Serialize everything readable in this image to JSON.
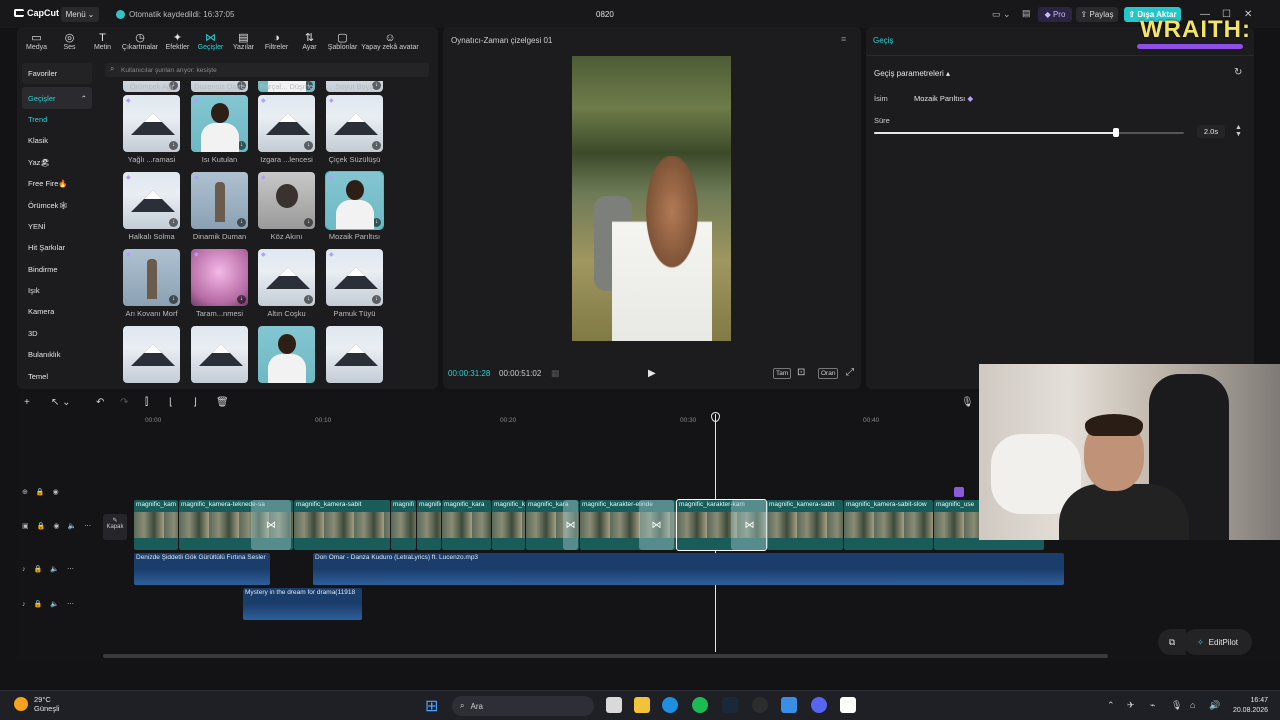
{
  "app": {
    "name": "CapCut",
    "menu_label": "Menü",
    "autosave": "Otomatik kaydedildi: 16:37:05",
    "project_title": "0820",
    "pro_label": "Pro",
    "share_label": "Paylaş",
    "export_label": "Dışa Aktar"
  },
  "toolbar": [
    {
      "label": "Medya",
      "icon": "media-icon"
    },
    {
      "label": "Ses",
      "icon": "audio-icon"
    },
    {
      "label": "Metin",
      "icon": "text-icon"
    },
    {
      "label": "Çıkartmalar",
      "icon": "sticker-icon"
    },
    {
      "label": "Efektler",
      "icon": "effects-icon"
    },
    {
      "label": "Geçişler",
      "icon": "transitions-icon"
    },
    {
      "label": "Yazılar",
      "icon": "captions-icon"
    },
    {
      "label": "Filtreler",
      "icon": "filters-icon"
    },
    {
      "label": "Ayar",
      "icon": "adjust-icon"
    },
    {
      "label": "Şablonlar",
      "icon": "templates-icon"
    },
    {
      "label": "Yapay zekâ avatar",
      "icon": "ai-avatar-icon"
    }
  ],
  "categories": {
    "favorites": "Favoriler",
    "transitions": "Geçişler",
    "items": [
      "Trend",
      "Klasik",
      "Yaz🏖",
      "Free Fire🔥",
      "Örümcek🕸",
      "YENİ",
      "Hit Şarkılar",
      "Bindirme",
      "Işık",
      "Kamera",
      "3D",
      "Bulanıklık",
      "Temel"
    ]
  },
  "search_placeholder": "Kullanıcılar şunları arıyor: kesişte",
  "transitions": {
    "top_row": [
      "Örümcek Ağı",
      "Düzensiz Daire",
      "Parçal... Düşme",
      "Soyut Boya"
    ],
    "row1": [
      "Yağlı ...ramasi",
      "Isı Kutulan",
      "Izgara ...lencesi",
      "Çiçek Süzülüşü"
    ],
    "row2": [
      "Halkalı Solma",
      "Dinamik Duman",
      "Köz Akını",
      "Mozaik Parıltısı"
    ],
    "row3": [
      "Arı Kovanı Morf",
      "Taram...nmesi",
      "Altın Coşku",
      "Pamuk Tüyü"
    ]
  },
  "player": {
    "title": "Oynatıcı-Zaman çizelgesi 01",
    "current_time": "00:00:31:28",
    "total_time": "00:00:51:02",
    "btn_full": "Tam",
    "btn_ratio": "Oran"
  },
  "details": {
    "title": "Geçiş",
    "section": "Geçiş parametreleri",
    "name_label": "İsim",
    "name_value": "Mozaik Parıltısı",
    "duration_label": "Süre",
    "duration_value": "2.0s",
    "duration_fraction": 0.78
  },
  "watermark": "WRAITH:",
  "timeline": {
    "ruler": [
      "00:00",
      "00:10",
      "00:20",
      "00:30",
      "00:40"
    ],
    "cover_label": "Kapak",
    "video_clips": [
      "magnific_kam",
      "magnific_kamera-teknede-sa",
      "magnific_kamera-sabit",
      "magnifi",
      "magnific",
      "magnific_kara",
      "magnific_karakte",
      "magnific_kara",
      "magnific_karakter-elinde",
      "magnific_karakter-kam",
      "magnific_kamera-sabit",
      "magnific_kamera-sabit-slow",
      "magnific_use"
    ],
    "audio1": [
      "Denizde Şiddetli Gök Gürültülü Fırtına Sesler",
      "Don Omar - Danza Kuduro (LetraLyrics) ft. Lucenzo.mp3"
    ],
    "audio2": "Mystery in the dream for drama(11918",
    "editpilot": "EditPilot"
  },
  "taskbar": {
    "temp": "29°C",
    "weather": "Güneşli",
    "search": "Ara",
    "time": "16:47",
    "date": "20.08.2026"
  }
}
